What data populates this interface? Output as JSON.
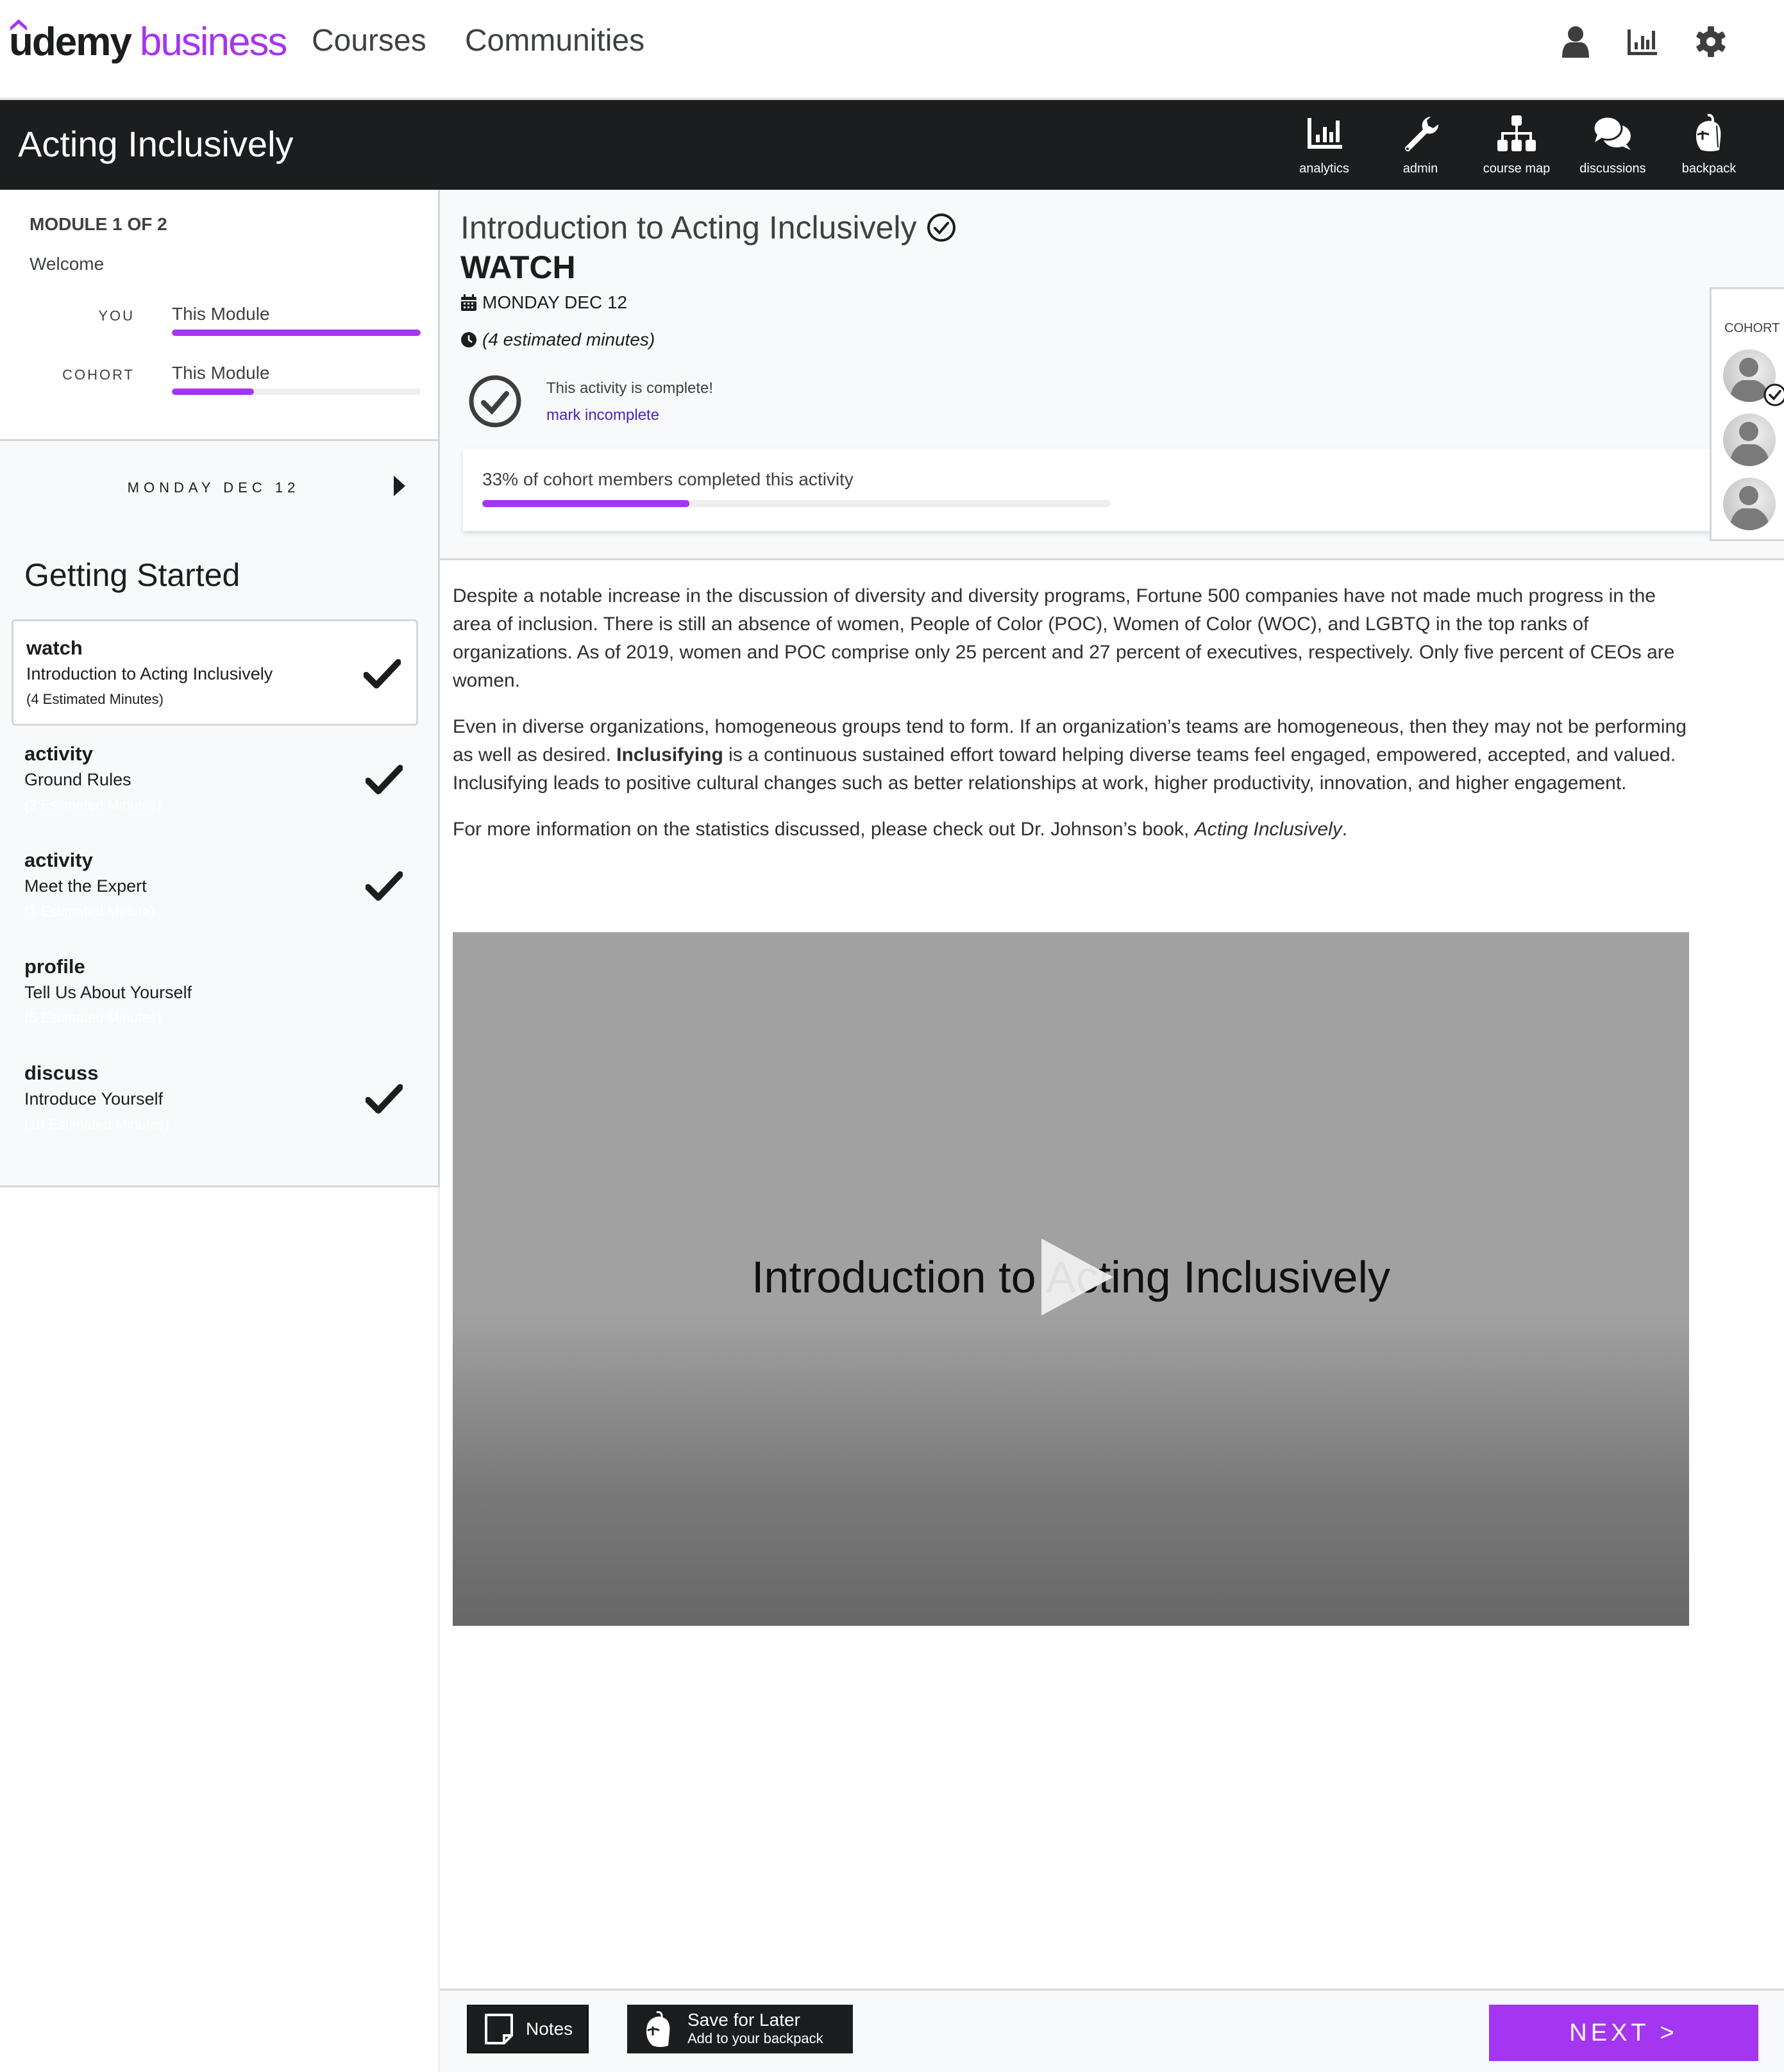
{
  "brand": {
    "primary": "udemy",
    "secondary": "business",
    "accent_color": "#a435f0"
  },
  "topnav": {
    "links": [
      "Courses",
      "Communities"
    ],
    "icons": [
      "user-icon",
      "analytics-icon",
      "settings-gear-icon"
    ]
  },
  "course": {
    "title": "Acting Inclusively",
    "tools": [
      {
        "label": "analytics",
        "icon": "bar-chart-icon"
      },
      {
        "label": "admin",
        "icon": "wrench-icon"
      },
      {
        "label": "course map",
        "icon": "sitemap-icon"
      },
      {
        "label": "discussions",
        "icon": "chat-bubbles-icon"
      },
      {
        "label": "backpack",
        "icon": "backpack-icon"
      }
    ]
  },
  "sidebar": {
    "module_label": "MODULE 1 OF 2",
    "module_name": "Welcome",
    "progress": [
      {
        "who": "YOU",
        "title": "This Module",
        "percent": 100
      },
      {
        "who": "COHORT",
        "title": "This Module",
        "percent": 33
      }
    ],
    "day_label": "MONDAY DEC 12",
    "section_title": "Getting Started",
    "activities": [
      {
        "type": "watch",
        "name": "Introduction to Acting Inclusively",
        "duration": "(4 Estimated Minutes)",
        "completed": true,
        "active": true
      },
      {
        "type": "activity",
        "name": "Ground Rules",
        "duration": "(2 Estimated Minutes)",
        "completed": true,
        "active": false
      },
      {
        "type": "activity",
        "name": "Meet the Expert",
        "duration": "(1 Estimated Minute)",
        "completed": true,
        "active": false
      },
      {
        "type": "profile",
        "name": "Tell Us About Yourself",
        "duration": "(5 Estimated Minutes)",
        "completed": false,
        "active": false
      },
      {
        "type": "discuss",
        "name": "Introduce Yourself",
        "duration": "(10 Estimated Minutes)",
        "completed": true,
        "active": false
      }
    ]
  },
  "activity": {
    "title": "Introduction to Acting Inclusively",
    "kind": "WATCH",
    "date": "MONDAY DEC 12",
    "time": "(4 estimated minutes)",
    "complete_text": "This activity is complete!",
    "mark_incomplete": "mark incomplete",
    "cohort_completion_text": "33% of cohort members completed this activity",
    "cohort_completion_percent": 33
  },
  "cohort_panel": {
    "label": "COHORT",
    "members": [
      {
        "completed": true
      },
      {
        "completed": false
      },
      {
        "completed": false
      }
    ]
  },
  "body": {
    "p1": "Despite a notable increase in the discussion of diversity and diversity programs, Fortune 500 companies have not made much progress in the area of inclusion. There is still an absence of women, People of Color (POC), Women of Color (WOC), and LGBTQ in the top ranks of organizations. As of 2019, women and POC comprise only 25 percent and 27 percent of executives, respectively. Only five percent of CEOs are women.",
    "p2_before": "Even in diverse organizations, homogeneous groups tend to form. If an organization’s teams are homogeneous, then they may not be performing as well as desired. ",
    "p2_bold": "Inclusifying",
    "p2_after": " is a continuous sustained effort toward helping diverse teams feel engaged, empowered, accepted, and valued. Inclusifying leads to positive cultural changes such as better relationships at work, higher productivity, innovation, and higher engagement.",
    "p3_before": "For more information on the statistics discussed, please check out Dr. Johnson’s book, ",
    "p3_italic": "Acting Inclusively",
    "p3_after": "."
  },
  "video": {
    "title": "Introduction to Acting Inclusively"
  },
  "bottombar": {
    "notes_label": "Notes",
    "save_title": "Save for Later",
    "save_subtitle": "Add to your backpack",
    "next_label": "NEXT >"
  }
}
